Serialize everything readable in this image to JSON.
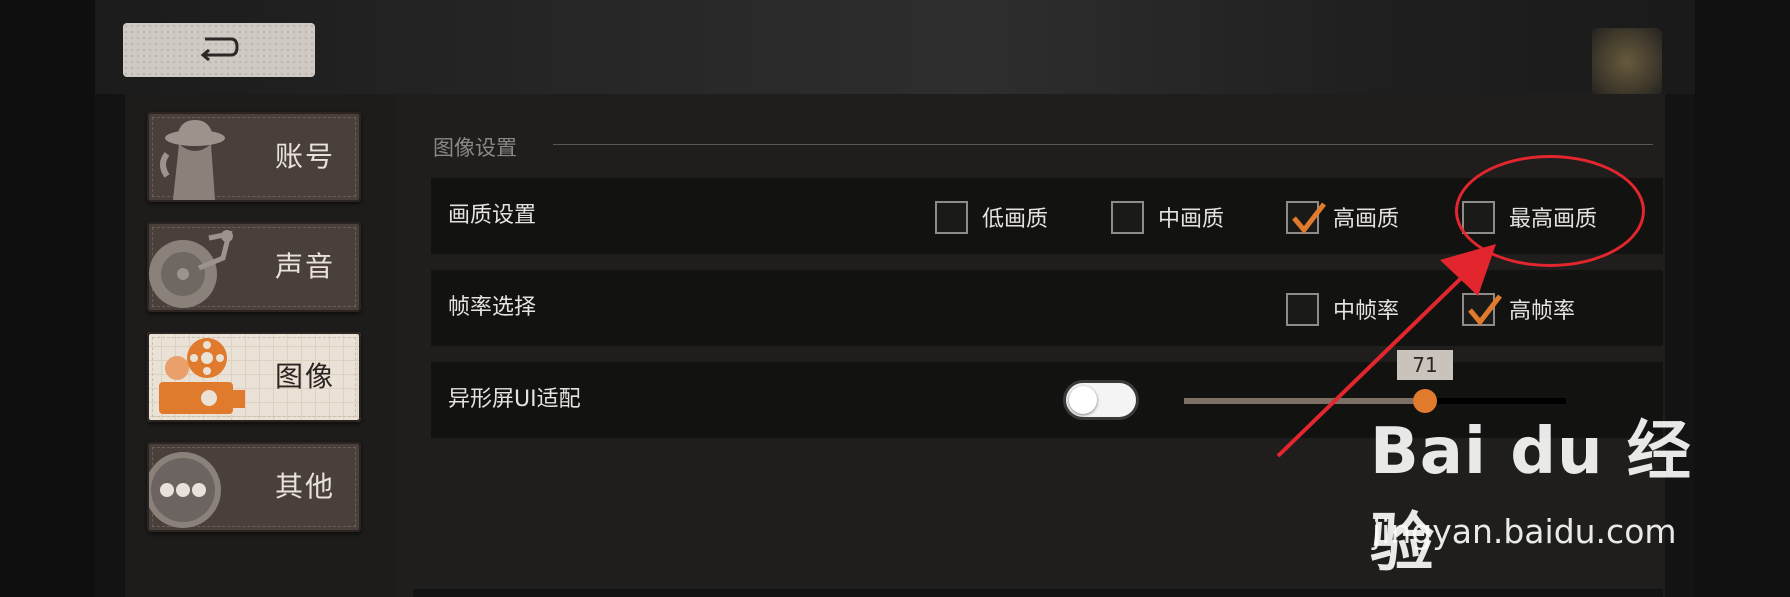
{
  "sidebar": {
    "items": [
      {
        "label": "账号",
        "icon": "detective-icon",
        "active": false
      },
      {
        "label": "声音",
        "icon": "record-player-icon",
        "active": false
      },
      {
        "label": "图像",
        "icon": "film-projector-icon",
        "active": true
      },
      {
        "label": "其他",
        "icon": "more-dots-icon",
        "active": false
      }
    ]
  },
  "back_button": {
    "icon": "back-arrow-icon"
  },
  "image_settings": {
    "section_title": "图像设置",
    "quality": {
      "label": "画质设置",
      "options": [
        {
          "label": "低画质",
          "checked": false
        },
        {
          "label": "中画质",
          "checked": false
        },
        {
          "label": "高画质",
          "checked": true
        },
        {
          "label": "最高画质",
          "checked": false
        }
      ]
    },
    "framerate": {
      "label": "帧率选择",
      "options": [
        {
          "label": "中帧率",
          "checked": false
        },
        {
          "label": "高帧率",
          "checked": true
        }
      ]
    },
    "notch": {
      "label": "异形屏UI适配",
      "toggle_on": false,
      "slider_value": "71",
      "slider_fraction": 0.63
    }
  },
  "watermark": {
    "brand": "Bai du 经验",
    "url": "jingyan.baidu.com"
  },
  "colors": {
    "accent": "#e07a2c",
    "annotation": "#e3262e",
    "active_tab": "#eae2d6"
  }
}
